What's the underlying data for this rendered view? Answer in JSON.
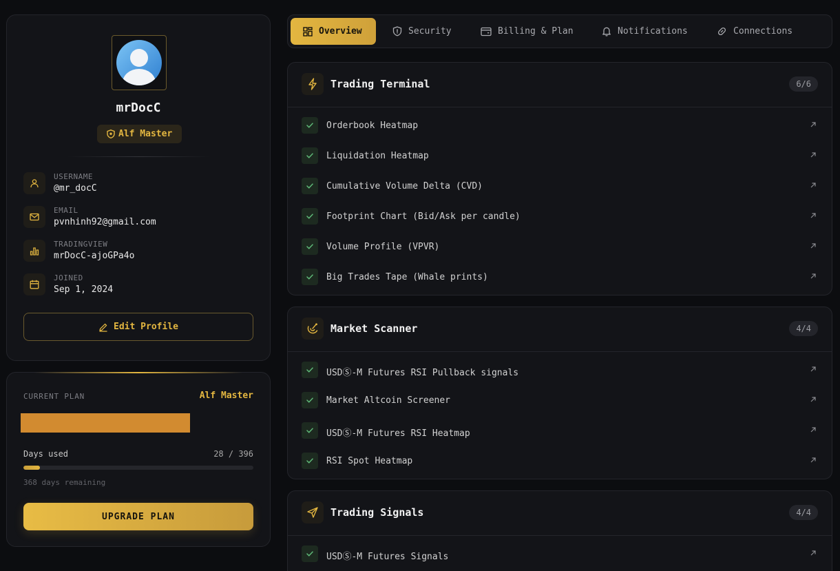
{
  "profile": {
    "display_name": "mrDocC",
    "role_badge": "Alf Master",
    "info": [
      {
        "label": "USERNAME",
        "value": "@mr_docC",
        "icon": "user-icon"
      },
      {
        "label": "EMAIL",
        "value": "pvnhinh92@gmail.com",
        "icon": "mail-icon"
      },
      {
        "label": "TRADINGVIEW",
        "value": "mrDocC-ajoGPa4o",
        "icon": "bar-chart-icon"
      },
      {
        "label": "JOINED",
        "value": "Sep 1, 2024",
        "icon": "calendar-icon"
      }
    ],
    "edit_label": "Edit Profile"
  },
  "plan": {
    "label": "CURRENT PLAN",
    "name": "Alf Master",
    "days_label": "Days used",
    "days_count": "28 / 396",
    "days_used": 28,
    "days_total": 396,
    "remaining": "368 days remaining",
    "upgrade_label": "UPGRADE PLAN"
  },
  "tabs": [
    {
      "label": "Overview",
      "icon": "grid-icon",
      "active": true
    },
    {
      "label": "Security",
      "icon": "shield-icon",
      "active": false
    },
    {
      "label": "Billing & Plan",
      "icon": "wallet-icon",
      "active": false
    },
    {
      "label": "Notifications",
      "icon": "bell-icon",
      "active": false
    },
    {
      "label": "Connections",
      "icon": "link-icon",
      "active": false
    }
  ],
  "sections": [
    {
      "title": "Trading Terminal",
      "count": "6/6",
      "icon": "lightning-icon",
      "items": [
        "Orderbook Heatmap",
        "Liquidation Heatmap",
        "Cumulative Volume Delta (CVD)",
        "Footprint Chart (Bid/Ask per candle)",
        "Volume Profile (VPVR)",
        "Big Trades Tape (Whale prints)"
      ]
    },
    {
      "title": "Market Scanner",
      "count": "4/4",
      "icon": "radar-icon",
      "items": [
        "USDⓈ-M Futures RSI Pullback signals",
        "Market Altcoin Screener",
        "USDⓈ-M Futures RSI Heatmap",
        "RSI Spot Heatmap"
      ]
    },
    {
      "title": "Trading Signals",
      "count": "4/4",
      "icon": "send-icon",
      "items": [
        "USDⓈ-M Futures Signals"
      ]
    }
  ],
  "colors": {
    "accent": "#e3b640",
    "check": "#5fb878",
    "plan_banner": "#d28b30"
  }
}
